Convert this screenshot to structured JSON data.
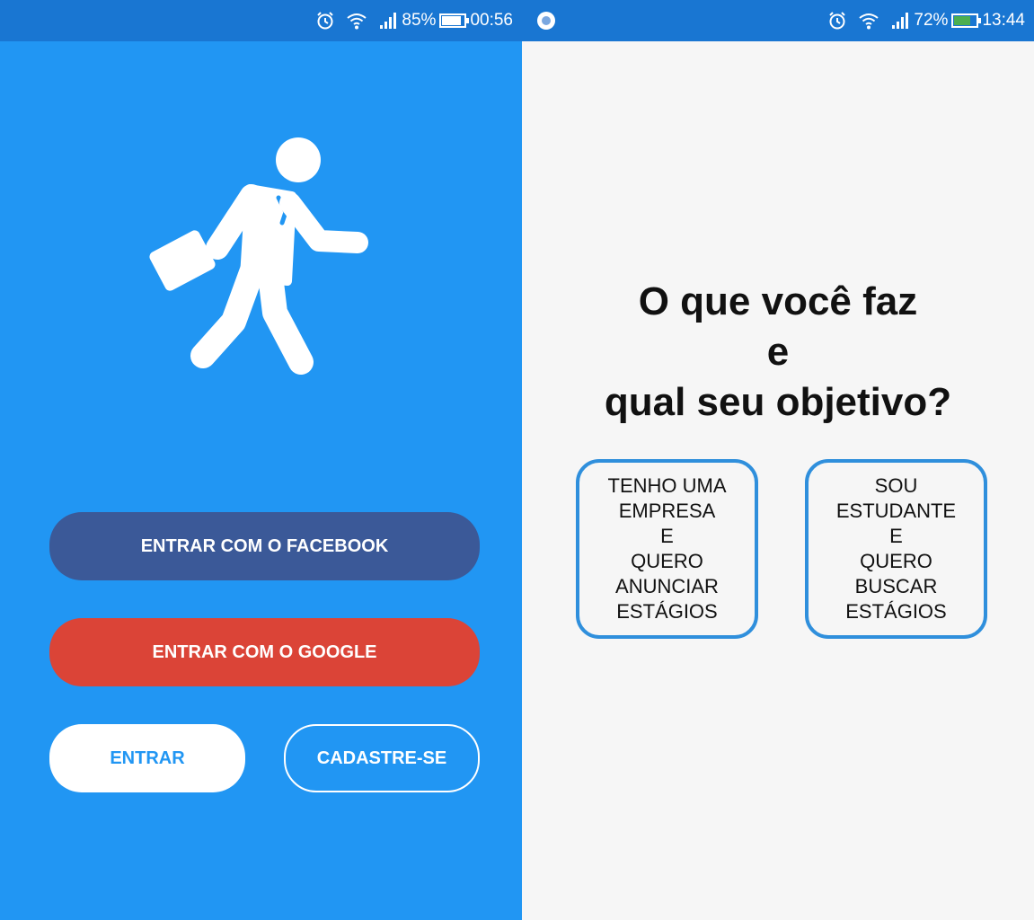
{
  "left_screen": {
    "status_bar": {
      "battery_percent": "85%",
      "battery_level": 0.85,
      "time": "00:56"
    },
    "buttons": {
      "facebook": "ENTRAR COM O FACEBOOK",
      "google": "ENTRAR COM O GOOGLE",
      "enter": "ENTRAR",
      "signup": "CADASTRE-SE"
    },
    "icon": "running-businessman-icon"
  },
  "right_screen": {
    "status_bar": {
      "battery_percent": "72%",
      "battery_level": 0.72,
      "charging": true,
      "time": "13:44"
    },
    "question": {
      "line1": "O que você faz",
      "line2": "e",
      "line3": "qual seu objetivo?"
    },
    "choices": {
      "company": "TENHO UMA\nEMPRESA\nE\nQUERO\nANUNCIAR\nESTÁGIOS",
      "student": "SOU\nESTUDANTE\nE\nQUERO\nBUSCAR\nESTÁGIOS"
    }
  },
  "colors": {
    "primary": "#2196f3",
    "status_bar": "#1976d2",
    "facebook": "#3b5998",
    "google": "#db4437",
    "choice_border": "#2f8fdc"
  }
}
